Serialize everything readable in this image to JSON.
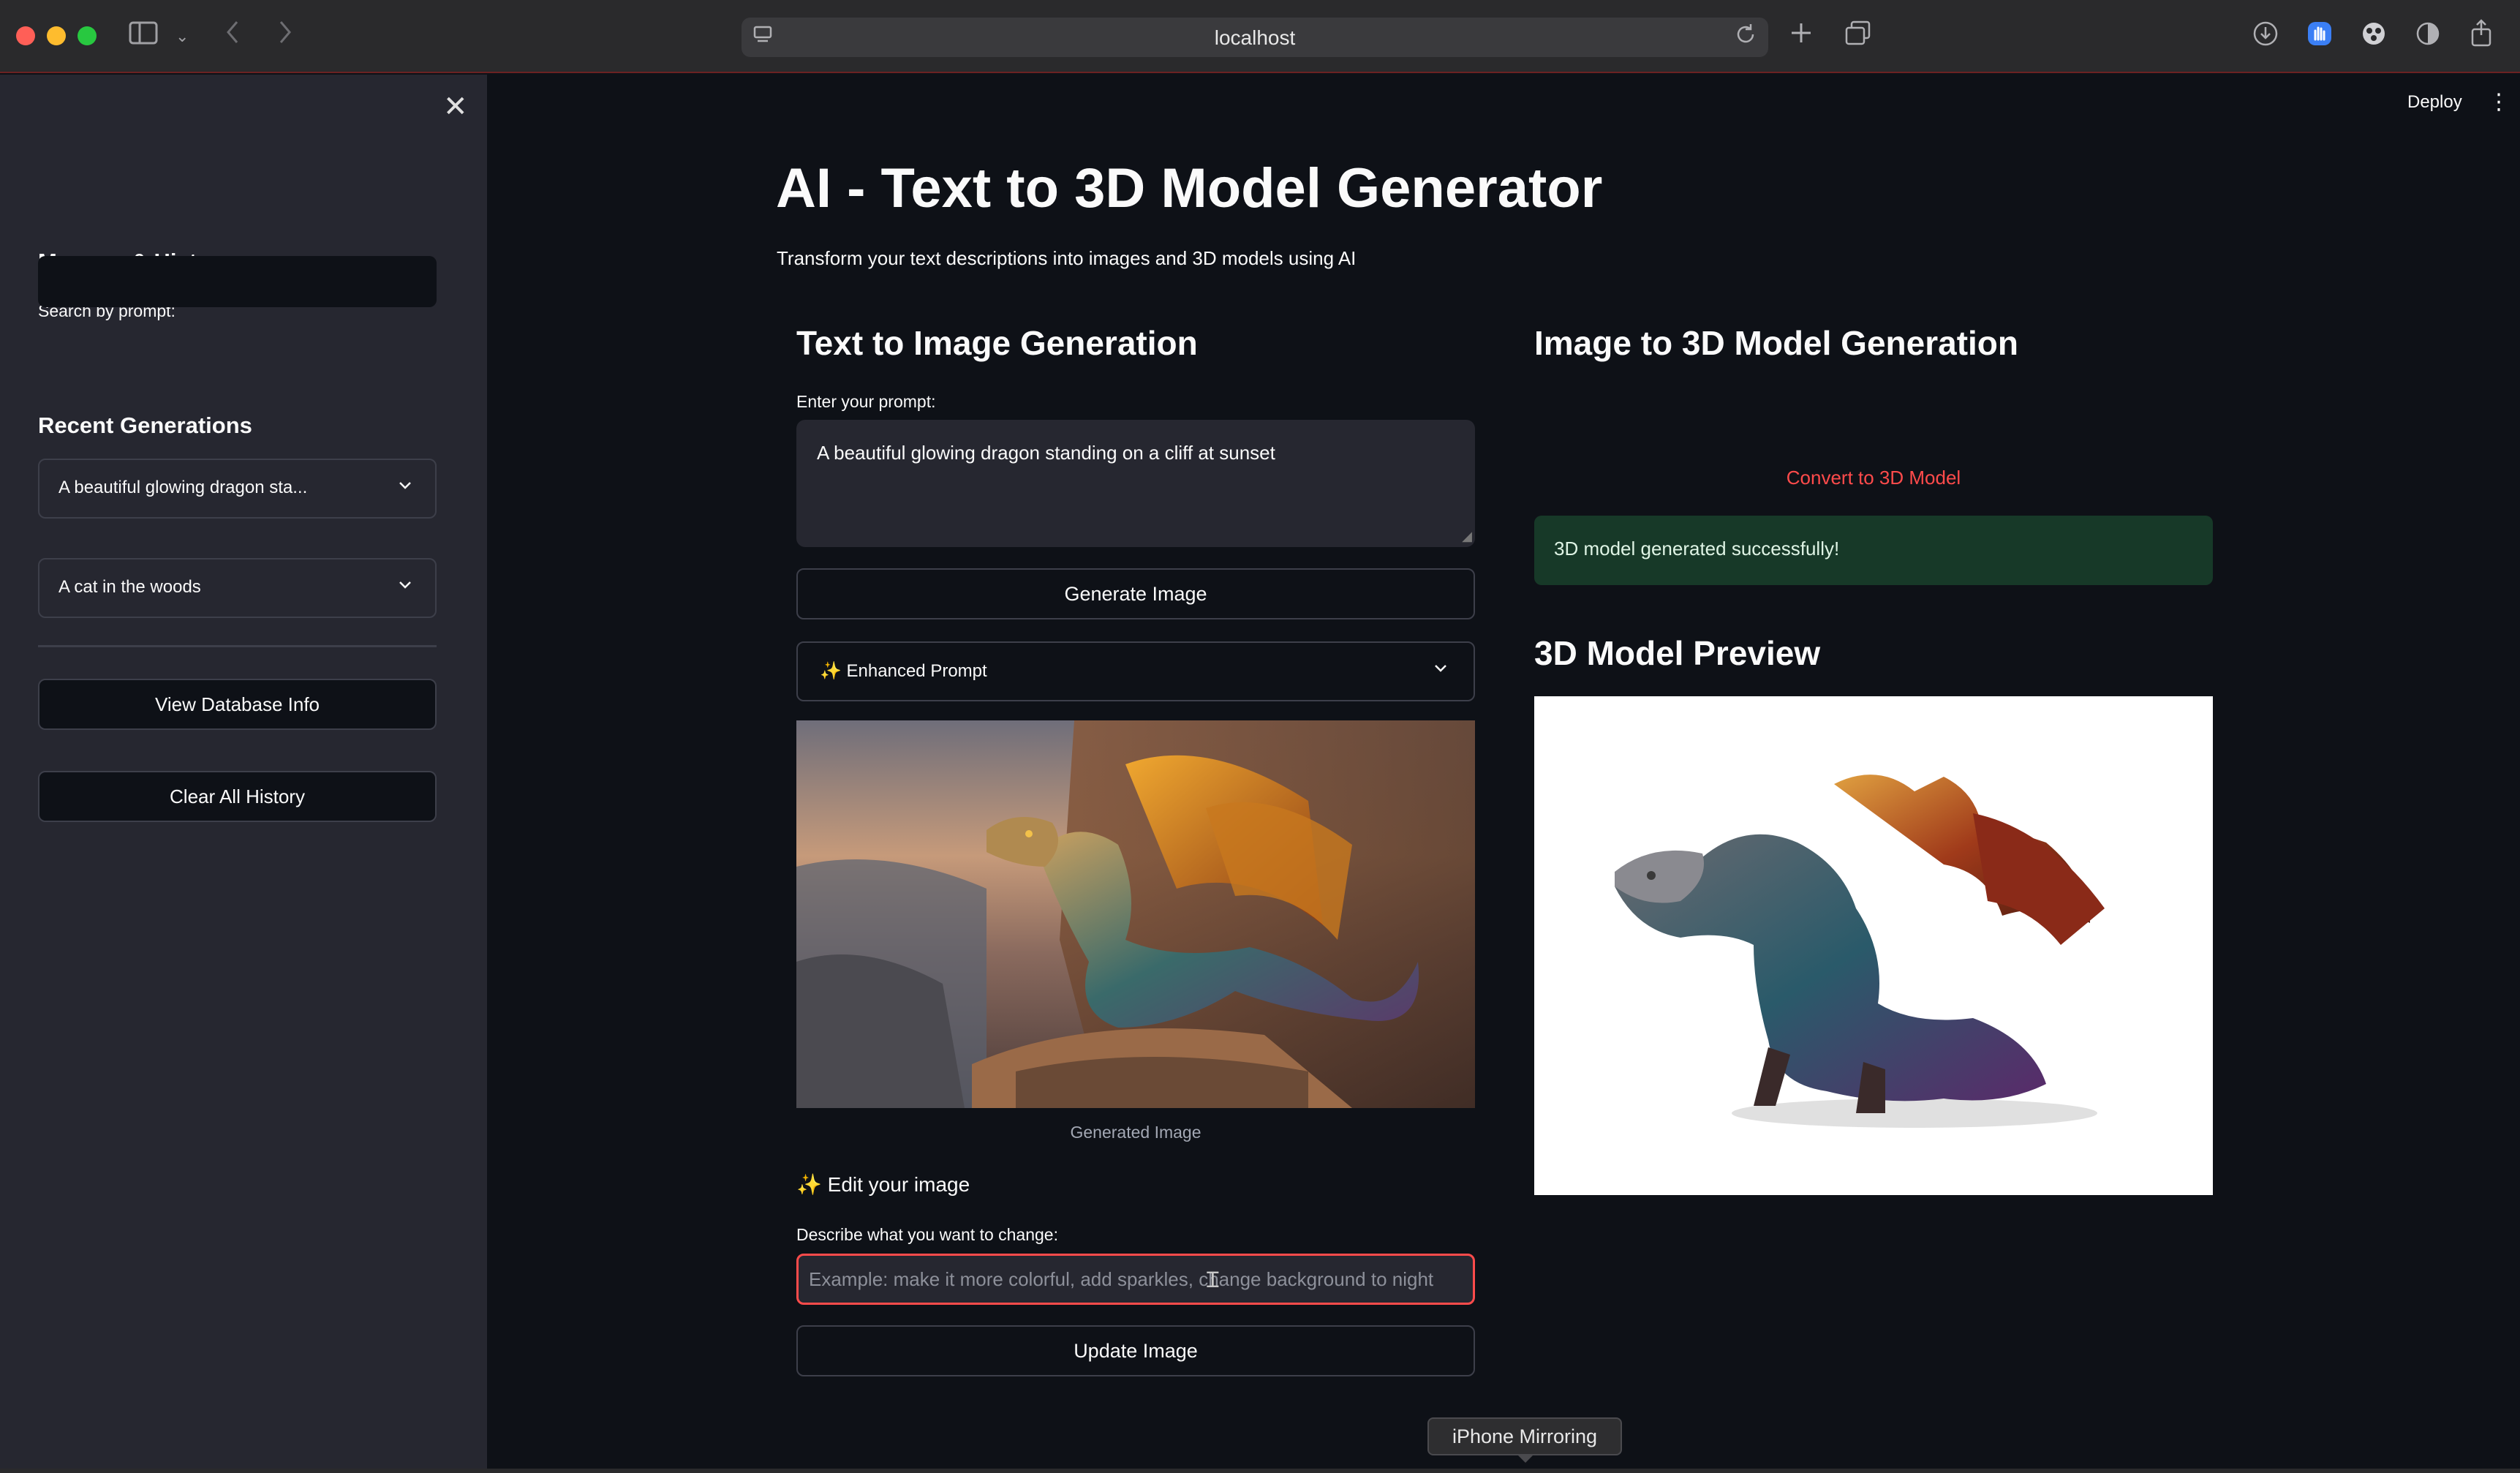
{
  "browser": {
    "url": "localhost"
  },
  "header": {
    "deploy_label": "Deploy"
  },
  "sidebar": {
    "memory_title": "Memory & History",
    "search_label": "Search by prompt:",
    "search_value": "",
    "recent_title": "Recent Generations",
    "recent_items": [
      {
        "label": "A beautiful glowing dragon sta..."
      },
      {
        "label": "A cat in the woods"
      }
    ],
    "view_db_label": "View Database Info",
    "clear_history_label": "Clear All History"
  },
  "main": {
    "title": "AI - Text to 3D Model Generator",
    "subtitle": "Transform your text descriptions into images and 3D models using AI",
    "text_to_image": {
      "heading": "Text to Image Generation",
      "prompt_label": "Enter your prompt:",
      "prompt_value": "A beautiful glowing dragon standing on a cliff at sunset",
      "generate_label": "Generate Image",
      "enhanced_prompt_label": "✨ Enhanced Prompt",
      "image_caption": "Generated Image",
      "edit_heading": "✨ Edit your image",
      "edit_label": "Describe what you want to change:",
      "edit_placeholder": "Example: make it more colorful, add sparkles, change background to night",
      "update_label": "Update Image"
    },
    "image_to_3d": {
      "heading": "Image to 3D Model Generation",
      "convert_label": "Convert to 3D Model",
      "success_message": "3D model generated successfully!",
      "preview_heading": "3D Model Preview"
    }
  },
  "tooltip": {
    "text": "iPhone Mirroring"
  },
  "colors": {
    "app_bg": "#0e1117",
    "sidebar_bg": "#262730",
    "accent_red": "#ff4b4b",
    "success_bg": "#173928"
  }
}
